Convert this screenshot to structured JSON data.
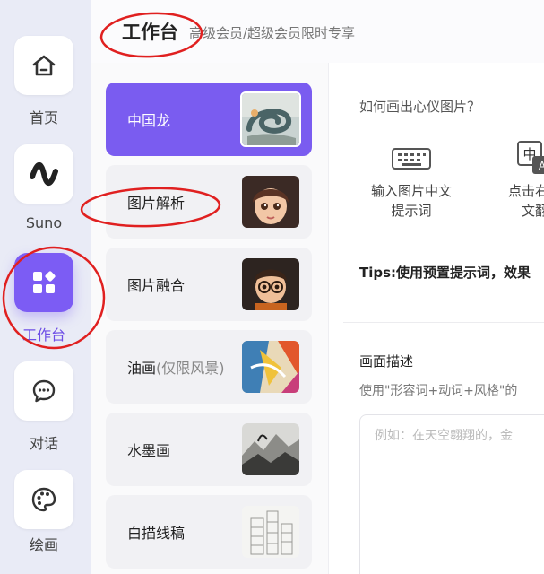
{
  "nav": {
    "items": [
      {
        "label": "首页",
        "icon": "home-icon"
      },
      {
        "label": "Suno",
        "icon": "suno-wave-icon"
      },
      {
        "label": "工作台",
        "icon": "workbench-grid-icon",
        "active": true
      },
      {
        "label": "对话",
        "icon": "chat-icon"
      },
      {
        "label": "绘画",
        "icon": "palette-icon"
      }
    ]
  },
  "header": {
    "title": "工作台",
    "subtitle": "高级会员/超级会员限时专享"
  },
  "styles": {
    "items": [
      {
        "label": "中国龙",
        "thumb": "dragon-thumbnail",
        "active": true
      },
      {
        "label": "图片解析",
        "thumb": "girl-portrait-thumbnail"
      },
      {
        "label": "图片融合",
        "thumb": "boy-cartoon-thumbnail"
      },
      {
        "label_main": "油画",
        "label_extra": "(仅限风景)",
        "thumb": "oil-painting-thumbnail"
      },
      {
        "label": "水墨画",
        "thumb": "ink-painting-thumbnail"
      },
      {
        "label": "白描线稿",
        "thumb": "line-sketch-thumbnail"
      }
    ]
  },
  "panel": {
    "question": "如何画出心仪图片？",
    "steps": [
      {
        "line1": "输入图片中文",
        "line2": "提示词",
        "icon": "keyboard-icon"
      },
      {
        "line1": "点击右上",
        "line2": "文翻",
        "icon": "translate-icon"
      }
    ],
    "translate_icon_text": "中",
    "translate_icon_sub": "A",
    "tips": "Tips:使用预置提示词，效果",
    "desc_title": "画面描述",
    "desc_hint": "使用\"形容词+动词+风格\"的",
    "placeholder": "例如：在天空翱翔的，金"
  },
  "colors": {
    "accent": "#7a5cf0",
    "annotation": "#e02020"
  }
}
